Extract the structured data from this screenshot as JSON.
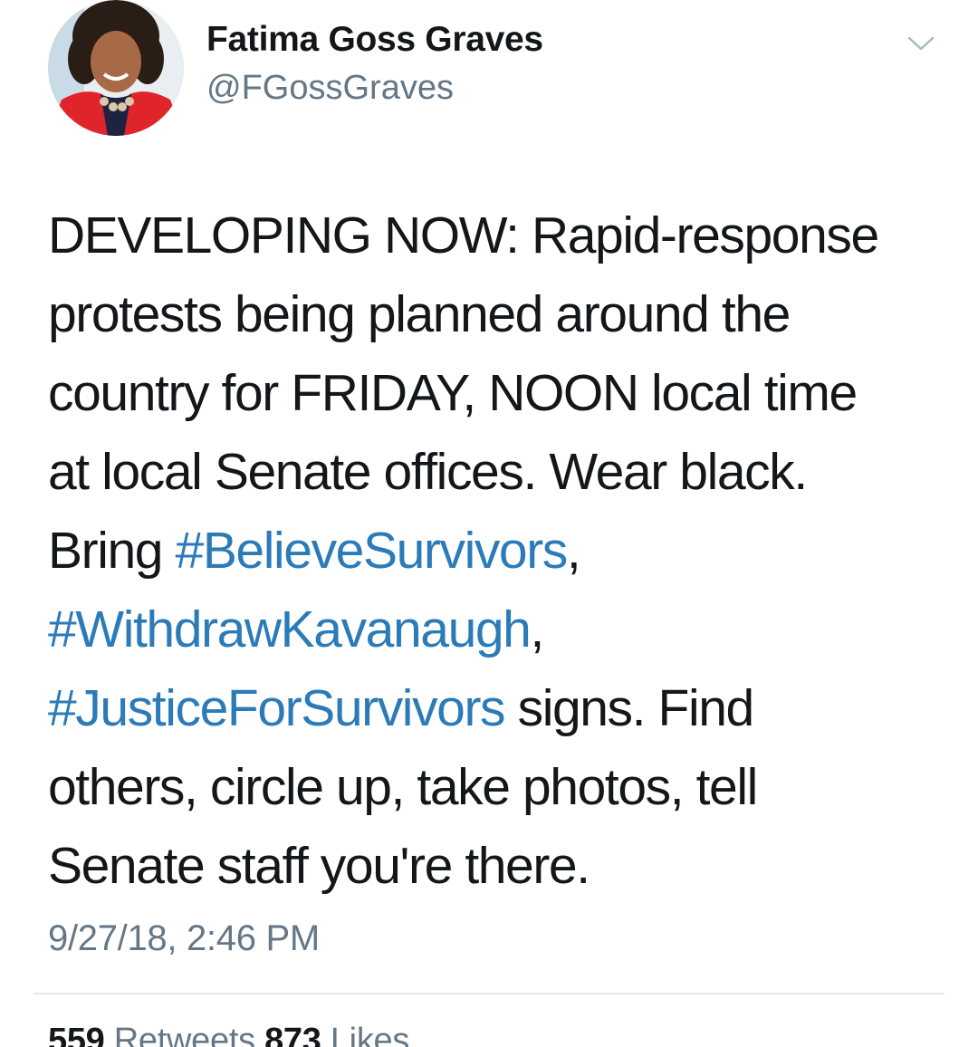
{
  "user": {
    "display_name": "Fatima Goss Graves",
    "handle": "@FGossGraves",
    "avatar_icon": "profile-photo-avatar"
  },
  "menu": {
    "icon": "chevron-down-icon"
  },
  "tweet": {
    "lines": [
      {
        "segments": [
          {
            "text": "DEVELOPING NOW: Rapid-response",
            "type": "text"
          }
        ]
      },
      {
        "segments": [
          {
            "text": "protests being planned around the",
            "type": "text"
          }
        ]
      },
      {
        "segments": [
          {
            "text": "country for FRIDAY, NOON local time",
            "type": "text"
          }
        ]
      },
      {
        "segments": [
          {
            "text": "at local Senate offices. Wear black.",
            "type": "text"
          }
        ]
      },
      {
        "segments": [
          {
            "text": "Bring ",
            "type": "text"
          },
          {
            "text": "#BelieveSurvivors",
            "type": "hashtag"
          },
          {
            "text": ",",
            "type": "text"
          }
        ]
      },
      {
        "segments": [
          {
            "text": "#WithdrawKavanaugh",
            "type": "hashtag"
          },
          {
            "text": ",",
            "type": "text"
          }
        ]
      },
      {
        "segments": [
          {
            "text": "#JusticeForSurvivors",
            "type": "hashtag"
          },
          {
            "text": " signs. Find",
            "type": "text"
          }
        ]
      },
      {
        "segments": [
          {
            "text": "others, circle up, take photos, tell",
            "type": "text"
          }
        ]
      },
      {
        "segments": [
          {
            "text": "Senate staff you're there.",
            "type": "text"
          }
        ]
      }
    ],
    "timestamp": "9/27/18, 2:46 PM"
  },
  "stats": {
    "retweets_count": "559",
    "retweets_label": "Retweets",
    "likes_count": "873",
    "likes_label": "Likes"
  },
  "colors": {
    "hashtag": "#2b7bb9",
    "secondary_text": "#657786",
    "primary_text": "#14171a",
    "divider": "#e1e8ed"
  }
}
